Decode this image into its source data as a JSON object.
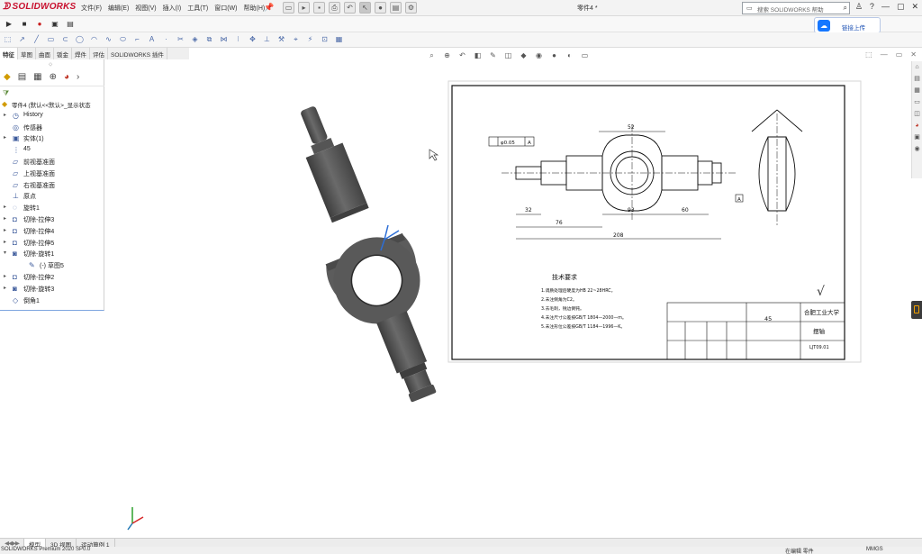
{
  "app": {
    "brand": "SOLIDWORKS",
    "document_title": "零件4 *",
    "colors": {
      "brand": "#c8102e",
      "accent": "#1677ff",
      "part": "#5b5b5b",
      "selection": "#2d6fd6"
    }
  },
  "menu": [
    "文件(F)",
    "编辑(E)",
    "视图(V)",
    "插入(I)",
    "工具(T)",
    "窗口(W)",
    "帮助(H)"
  ],
  "search": {
    "placeholder": "搜索 SOLIDWORKS 帮助"
  },
  "window_controls": [
    "?",
    "—",
    "▢",
    "✕"
  ],
  "cloud": {
    "label": "链接上传"
  },
  "tabs": [
    "特征",
    "草图",
    "曲面",
    "钣金",
    "焊件",
    "评估",
    "SOLIDWORKS 插件"
  ],
  "active_tab": "特征",
  "tree": {
    "root": "零件4 (默认<<默认>_显示状态",
    "items": [
      {
        "label": "History",
        "icon": "history-icon",
        "expand": true
      },
      {
        "label": "传感器",
        "icon": "sensor-icon",
        "expand": false
      },
      {
        "label": "实体(1)",
        "icon": "solid-bodies-icon",
        "expand": true
      },
      {
        "label": "45",
        "icon": "material-icon",
        "expand": false
      },
      {
        "label": "前视基准面",
        "icon": "plane-icon",
        "expand": false
      },
      {
        "label": "上视基准面",
        "icon": "plane-icon",
        "expand": false
      },
      {
        "label": "右视基准面",
        "icon": "plane-icon",
        "expand": false
      },
      {
        "label": "原点",
        "icon": "origin-icon",
        "expand": false
      },
      {
        "label": "旋转1",
        "icon": "revolve-icon",
        "expand": true
      },
      {
        "label": "切除-拉伸3",
        "icon": "cut-extrude-icon",
        "expand": true
      },
      {
        "label": "切除-拉伸4",
        "icon": "cut-extrude-icon",
        "expand": true
      },
      {
        "label": "切除-拉伸5",
        "icon": "cut-extrude-icon",
        "expand": true
      },
      {
        "label": "切除-旋转1",
        "icon": "cut-revolve-icon",
        "expand": true,
        "open": true
      },
      {
        "label": "(-) 草图5",
        "icon": "sketch-icon",
        "expand": false,
        "child": true
      },
      {
        "label": "切除-拉伸2",
        "icon": "cut-extrude-icon",
        "expand": true
      },
      {
        "label": "切除-旋转3",
        "icon": "cut-revolve-icon",
        "expand": true
      },
      {
        "label": "倒角1",
        "icon": "chamfer-icon",
        "expand": false
      }
    ]
  },
  "drawing": {
    "dims": [
      "52",
      "32",
      "76",
      "93",
      "60",
      "208"
    ],
    "tolerance_label": "φ0.05",
    "datum": "A",
    "tech_req_title": "技术要求",
    "tech_req": [
      "1.调质处理后硬度为HB 22~28HRC。",
      "2.未注倒角为C2。",
      "3.去毛刺，锐边倒钝。",
      "4.未注尺寸公差按GB/T 1804—2000—m。",
      "5.未注形位公差按GB/T 1184—1996—K。"
    ],
    "material": "45",
    "school": "合肥工业大学",
    "part_name": "摆轴",
    "drawing_no": "LJT09.01"
  },
  "bottom_tabs": [
    "模型",
    "3D 视图",
    "运动算例 1"
  ],
  "active_bottom_tab": "模型",
  "status": {
    "left": "SOLIDWORKS Premium 2020 SP0.0",
    "right1": "在编辑 零件",
    "right2": "MMGS"
  }
}
